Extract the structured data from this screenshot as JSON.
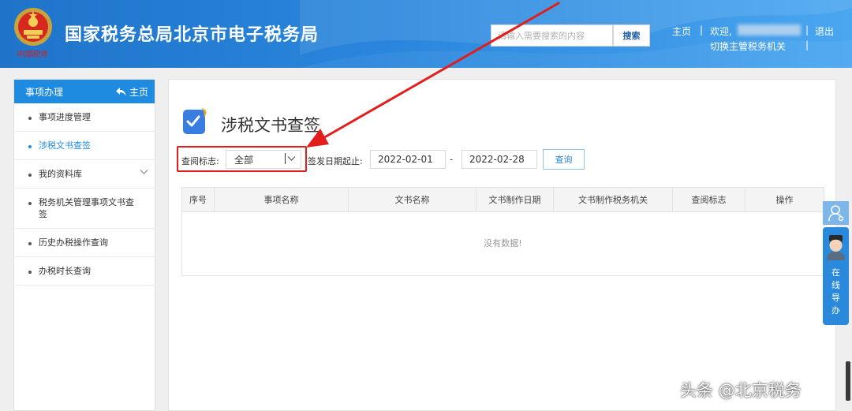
{
  "header": {
    "title": "国家税务总局北京市电子税务局",
    "emblem_caption": "中国税务",
    "search_placeholder": "请输入需要搜索的内容",
    "search_button": "搜索",
    "home_link": "主页",
    "divider": "|",
    "welcome": "欢迎,",
    "logout": "退出",
    "switch_org": "切换主管税务机关"
  },
  "sidebar": {
    "title": "事项办理",
    "home_label": "主页",
    "items": [
      {
        "label": "事项进度管理"
      },
      {
        "label": "涉税文书查签"
      },
      {
        "label": "我的资料库"
      },
      {
        "label": "税务机关管理事项文书查签"
      },
      {
        "label": "历史办税操作查询"
      },
      {
        "label": "办税时长查询"
      }
    ]
  },
  "main": {
    "title": "涉税文书查签",
    "filter": {
      "status_label": "查阅标志:",
      "status_value": "全部",
      "date_label": "签发日期起止:",
      "date_from": "2022-02-01",
      "date_sep": "-",
      "date_to": "2022-02-28",
      "query_button": "查询"
    },
    "table": {
      "columns": [
        "序号",
        "事项名称",
        "文书名称",
        "文书制作日期",
        "文书制作税务机关",
        "查阅标志",
        "操作"
      ],
      "empty_message": "没有数据!"
    }
  },
  "float": {
    "guide_label": "在线导办"
  },
  "watermark": "头条 @北京税务",
  "colors": {
    "header_blue": "#1f74c9",
    "sidebar_blue": "#1f8be0",
    "highlight_red": "#e31c1c"
  }
}
